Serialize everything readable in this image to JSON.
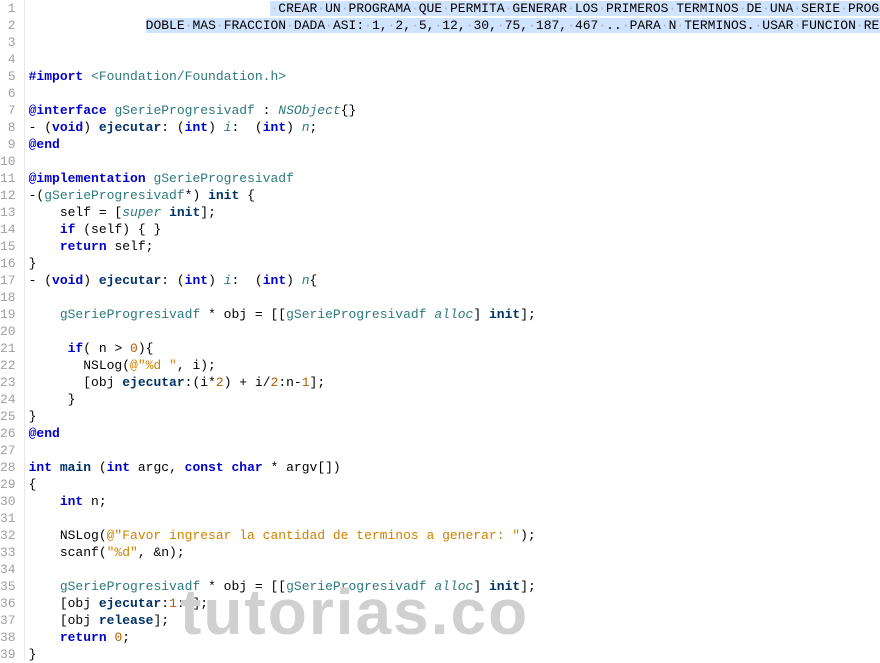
{
  "watermark": "tutorias.co",
  "lines": [
    {
      "n": 1,
      "html": "<span class='plain'>                               </span><span class='highlight'><span class='dot'>·</span>CREAR<span class='dot'>·</span>UN<span class='dot'>·</span>PROGRAMA<span class='dot'>·</span>QUE<span class='dot'>·</span>PERMITA<span class='dot'>·</span>GENERAR<span class='dot'>·</span>LOS<span class='dot'>·</span>PRIMEROS<span class='dot'>·</span>TERMINOS<span class='dot'>·</span>DE<span class='dot'>·</span>UNA<span class='dot'>·</span>SERIE<span class='dot'>·</span>PROGRESIVA</span>"
    },
    {
      "n": 2,
      "html": "<span class='plain'>               </span><span class='highlight'>DOBLE<span class='dot'>·</span>MAS<span class='dot'>·</span>FRACCION<span class='dot'>·</span>DADA<span class='dot'>·</span>ASI:<span class='dot'>·</span>1,<span class='dot'>·</span>2,<span class='dot'>·</span>5,<span class='dot'>·</span>12,<span class='dot'>·</span>30,<span class='dot'>·</span>75,<span class='dot'>·</span>187,<span class='dot'>·</span>467<span class='dot'>·</span>..<span class='dot'>·</span>PARA<span class='dot'>·</span>N<span class='dot'>·</span>TERMINOS.<span class='dot'>·</span>USAR<span class='dot'>·</span>FUNCION<span class='dot'>·</span>RECURSIVA</span>"
    },
    {
      "n": 3,
      "html": ""
    },
    {
      "n": 4,
      "html": ""
    },
    {
      "n": 5,
      "html": "<span class='kw'>#import</span> <span class='ang'>&lt;Foundation/Foundation.h&gt;</span>"
    },
    {
      "n": 6,
      "html": ""
    },
    {
      "n": 7,
      "html": "<span class='kw'>@interface</span> <span class='cls'>gSerieProgresivadf</span> : <span class='type'>NSObject</span>{}"
    },
    {
      "n": 8,
      "html": "- (<span class='kw'>void</span>) <span class='fn'>ejecutar</span>: (<span class='kw'>int</span>) <span class='type'>i</span>:  (<span class='kw'>int</span>) <span class='type'>n</span>;"
    },
    {
      "n": 9,
      "html": "<span class='kw'>@end</span>"
    },
    {
      "n": 10,
      "html": ""
    },
    {
      "n": 11,
      "html": "<span class='kw'>@implementation</span> <span class='cls'>gSerieProgresivadf</span>"
    },
    {
      "n": 12,
      "html": "-(<span class='cls'>gSerieProgresivadf</span>*) <span class='fn'>init</span> {"
    },
    {
      "n": 13,
      "html": "    self = [<span class='type'>super</span> <span class='fn'>init</span>];"
    },
    {
      "n": 14,
      "html": "    <span class='kw'>if</span> (self) { }"
    },
    {
      "n": 15,
      "html": "    <span class='kw'>return</span> self;"
    },
    {
      "n": 16,
      "html": "}"
    },
    {
      "n": 17,
      "html": "- (<span class='kw'>void</span>) <span class='fn'>ejecutar</span>: (<span class='kw'>int</span>) <span class='type'>i</span>:  (<span class='kw'>int</span>) <span class='type'>n</span>{"
    },
    {
      "n": 18,
      "html": ""
    },
    {
      "n": 19,
      "html": "    <span class='cls'>gSerieProgresivadf</span> * obj = [[<span class='cls'>gSerieProgresivadf</span> <span class='type'>alloc</span>] <span class='fn'>init</span>];"
    },
    {
      "n": 20,
      "html": ""
    },
    {
      "n": 21,
      "html": "     <span class='kw'>if</span>( n &gt; <span class='num'>0</span>){"
    },
    {
      "n": 22,
      "html": "       NSLog(<span class='str'>@\"%d \"</span>, i);"
    },
    {
      "n": 23,
      "html": "       [obj <span class='fn'>ejecutar</span>:(i*<span class='num'>2</span>) + i/<span class='num'>2</span>:n-<span class='num'>1</span>];"
    },
    {
      "n": 24,
      "html": "     }"
    },
    {
      "n": 25,
      "html": "}"
    },
    {
      "n": 26,
      "html": "<span class='kw'>@end</span>"
    },
    {
      "n": 27,
      "html": ""
    },
    {
      "n": 28,
      "html": "<span class='kw'>int</span> <span class='fn'>main</span> (<span class='kw'>int</span> argc, <span class='kw'>const</span> <span class='kw'>char</span> * argv[])"
    },
    {
      "n": 29,
      "html": "{"
    },
    {
      "n": 30,
      "html": "    <span class='kw'>int</span> n;"
    },
    {
      "n": 31,
      "html": ""
    },
    {
      "n": 32,
      "html": "    NSLog(<span class='str'>@\"Favor ingresar la cantidad de terminos a generar: \"</span>);"
    },
    {
      "n": 33,
      "html": "    scanf(<span class='str'>\"%d\"</span>, &amp;n);"
    },
    {
      "n": 34,
      "html": ""
    },
    {
      "n": 35,
      "html": "    <span class='cls'>gSerieProgresivadf</span> * obj = [[<span class='cls'>gSerieProgresivadf</span> <span class='type'>alloc</span>] <span class='fn'>init</span>];"
    },
    {
      "n": 36,
      "html": "    [obj <span class='fn'>ejecutar</span>:<span class='num'>1</span>:n];"
    },
    {
      "n": 37,
      "html": "    [obj <span class='fn'>release</span>];"
    },
    {
      "n": 38,
      "html": "    <span class='kw'>return</span> <span class='num'>0</span>;"
    },
    {
      "n": 39,
      "html": "}"
    }
  ]
}
